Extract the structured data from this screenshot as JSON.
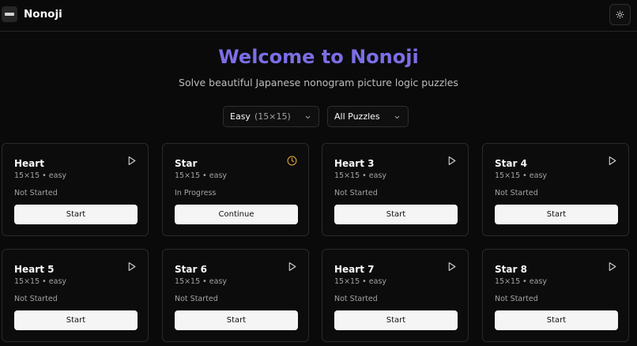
{
  "app": {
    "name": "Nonoji"
  },
  "hero": {
    "title": "Welcome to Nonoji",
    "subtitle": "Solve beautiful Japanese nonogram picture logic puzzles"
  },
  "filters": {
    "difficulty": {
      "label": "Easy",
      "detail": "(15×15)"
    },
    "category": {
      "label": "All Puzzles"
    }
  },
  "colors": {
    "accent": "#7c6ee6",
    "in_progress": "#e0a23a"
  },
  "puzzles": [
    {
      "title": "Heart",
      "meta": "15×15 • easy",
      "status": "Not Started",
      "action": "Start",
      "icon": "play-icon"
    },
    {
      "title": "Star",
      "meta": "15×15 • easy",
      "status": "In Progress",
      "action": "Continue",
      "icon": "clock-icon"
    },
    {
      "title": "Heart 3",
      "meta": "15×15 • easy",
      "status": "Not Started",
      "action": "Start",
      "icon": "play-icon"
    },
    {
      "title": "Star 4",
      "meta": "15×15 • easy",
      "status": "Not Started",
      "action": "Start",
      "icon": "play-icon"
    },
    {
      "title": "Heart 5",
      "meta": "15×15 • easy",
      "status": "Not Started",
      "action": "Start",
      "icon": "play-icon"
    },
    {
      "title": "Star 6",
      "meta": "15×15 • easy",
      "status": "Not Started",
      "action": "Start",
      "icon": "play-icon"
    },
    {
      "title": "Heart 7",
      "meta": "15×15 • easy",
      "status": "Not Started",
      "action": "Start",
      "icon": "play-icon"
    },
    {
      "title": "Star 8",
      "meta": "15×15 • easy",
      "status": "Not Started",
      "action": "Start",
      "icon": "play-icon"
    }
  ]
}
